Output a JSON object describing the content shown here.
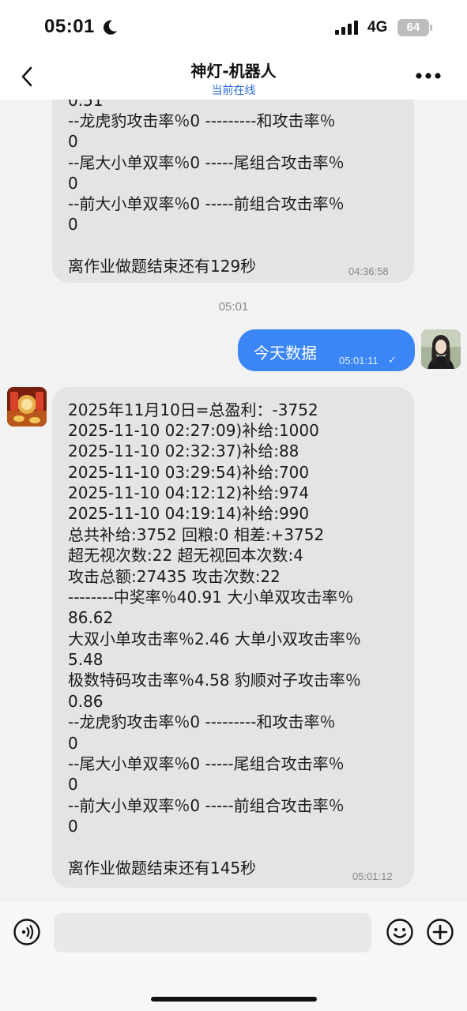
{
  "status_bar": {
    "time": "05:01",
    "network": "4G",
    "battery": "64"
  },
  "nav": {
    "title": "神灯-机器人",
    "status": "当前在线"
  },
  "messages": {
    "prev_partial": {
      "cut_top": "0.51",
      "lines": [
        "--龙虎豹攻击率％0   ---------和攻击率％",
        "0",
        "--尾大小单双率％0   -----尾组合攻击率％",
        "0",
        "--前大小单双率％0   -----前组合攻击率％",
        "0",
        "",
        "离作业做题结束还有129秒"
      ],
      "time": "04:36:58"
    },
    "center_time": "05:01",
    "outgoing": {
      "text": "今天数据",
      "time": "05:01:11",
      "check": "✓"
    },
    "incoming": {
      "lines": [
        "2025年11月10日=总盈利：-3752",
        "2025-11-10 02:27:09)补给:1000",
        "2025-11-10 02:32:37)补给:88",
        "2025-11-10 03:29:54)补给:700",
        "2025-11-10 04:12:12)补给:974",
        "2025-11-10 04:19:14)补给:990",
        "总共补给:3752 回粮:0 相差:+3752",
        "超无视次数:22  超无视回本次数:4",
        "攻击总额:27435  攻击次数:22",
        "--------中奖率％40.91  大小单双攻击率％",
        "86.62",
        "大双小单攻击率％2.46  大单小双攻击率％",
        "5.48",
        "极数特码攻击率％4.58  豹顺对子攻击率％",
        "0.86",
        "--龙虎豹攻击率％0   ---------和攻击率％",
        "0",
        "--尾大小单双率％0   -----尾组合攻击率％",
        "0",
        "--前大小单双率％0   -----前组合攻击率％",
        "0",
        "",
        "离作业做题结束还有145秒"
      ],
      "time": "05:01:12"
    }
  },
  "icons": {
    "back": "chevron-left-icon",
    "more": "more-dots-icon",
    "voice": "voice-icon",
    "emoji": "emoji-icon",
    "plus": "plus-icon"
  },
  "colors": {
    "accent": "#3b86f5",
    "online": "#2a6ad8",
    "bubble_in": "#e4e4e4",
    "chat_bg": "#f2f2f2"
  }
}
